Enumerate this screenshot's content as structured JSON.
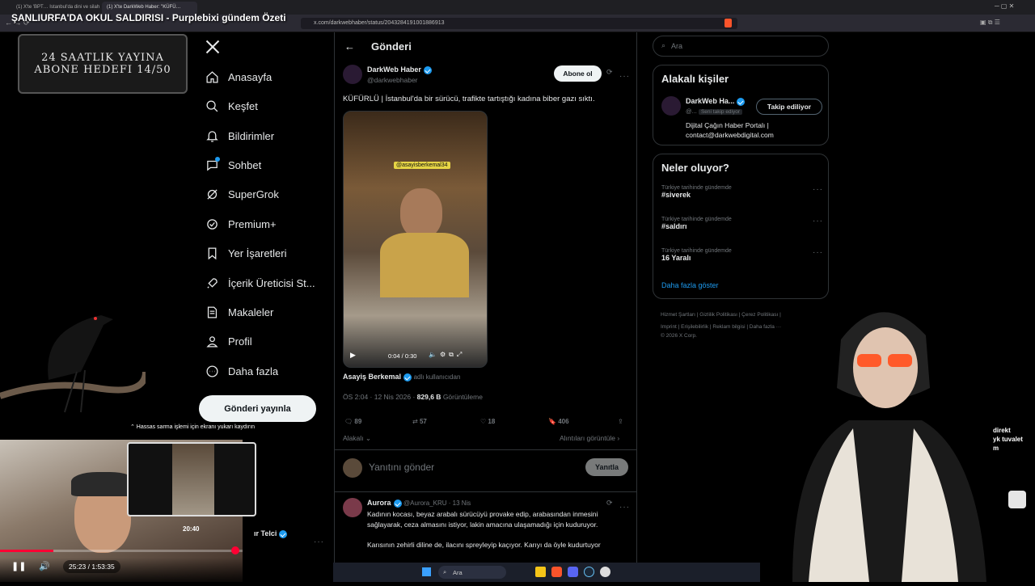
{
  "stream_title": "ŞANLIURFA'DA OKUL SALDIRISI - Purplebixi gündem Özeti",
  "browser": {
    "tabs": [
      "(1) X'te 'BPT… Istanbul'da dini ve silah…",
      "(1) X'te DarkWeb Haber: \"KÜFÜ…"
    ],
    "url": "x.com/darkwebhaber/status/2043284191001886913"
  },
  "overlay": {
    "banner_line1": "24 SAATLIK YAYINA",
    "banner_line2": "ABONE HEDEFI 14/50",
    "scroll_hint": "Hassas sarma işlemi için ekranı yukarı kaydırın",
    "preview_time": "20:40",
    "player_time": "25:23 / 1:53:35",
    "side_text": "direkt\nyk tuvalet\nm"
  },
  "nav": {
    "items": [
      {
        "label": "Anasayfa",
        "icon": "home-icon"
      },
      {
        "label": "Keşfet",
        "icon": "search-icon"
      },
      {
        "label": "Bildirimler",
        "icon": "bell-icon"
      },
      {
        "label": "Sohbet",
        "icon": "chat-icon"
      },
      {
        "label": "SuperGrok",
        "icon": "grok-icon"
      },
      {
        "label": "Premium+",
        "icon": "premium-icon"
      },
      {
        "label": "Yer İşaretleri",
        "icon": "bookmark-icon"
      },
      {
        "label": "İçerik Üreticisi St...",
        "icon": "rocket-icon"
      },
      {
        "label": "Makaleler",
        "icon": "article-icon"
      },
      {
        "label": "Profil",
        "icon": "person-icon"
      },
      {
        "label": "Daha fazla",
        "icon": "more-circle-icon"
      }
    ],
    "post_button": "Gönderi yayınla",
    "account_name": "ır Telci"
  },
  "post": {
    "header_title": "Gönderi",
    "author_name": "DarkWeb Haber",
    "author_handle": "@darkwebhaber",
    "subscribe_label": "Abone ol",
    "text": "KÜFÜRLÜ | İstanbul'da bir sürücü, trafikte tartıştığı kadına biber gazı sıktı.",
    "video_watermark": "@asayisberkemal34",
    "video_time": "0:04 / 0:30",
    "source_name": "Asayiş Berkemal",
    "source_suffix": "adlı kullanıcıdan",
    "timestamp": "ÖS 2:04 · 12 Nis 2026 · ",
    "views_count": "829,6 B",
    "views_label": " Görüntüleme",
    "replies": "89",
    "reposts": "57",
    "likes": "18",
    "bookmarks": "406",
    "sort_label": "Alakalı",
    "quotes_label": "Alıntıları görüntüle",
    "reply_placeholder": "Yanıtını gönder",
    "reply_button": "Yanıtla"
  },
  "reply": {
    "author_name": "Aurora",
    "meta": "@Aurora_KRU · 13 Nis",
    "line1": "Kadının kocası, beyaz arabalı sürücüyü provake edip, arabasından inmesini",
    "line2": "sağlayarak, ceza almasını istiyor, lakin amacına ulaşamadığı için kuduruyor.",
    "line3": "Karısının zehirli diline de, ilacını spreyleyip kaçıyor. Karıyı da öyle kudurtuyor"
  },
  "sidebar": {
    "search_placeholder": "Ara",
    "related_title": "Alakalı kişiler",
    "related_name": "DarkWeb Ha...",
    "related_handle": "@...",
    "related_badge": "Seni takip ediyor",
    "related_button": "Takip ediliyor",
    "related_bio_line1": "Dijital Çağın Haber Portalı |",
    "related_bio_line2": "contact@darkwebdigital.com",
    "trends_title": "Neler oluyor?",
    "trends": [
      {
        "kicker": "Türkiye tarihinde gündemde",
        "name": "#siverek"
      },
      {
        "kicker": "Türkiye tarihinde gündemde",
        "name": "#saldırı"
      },
      {
        "kicker": "Türkiye tarihinde gündemde",
        "name": "16 Yaralı"
      }
    ],
    "show_more": "Daha fazla göster",
    "footer_line1": "Hizmet Şartları  |  Gizlilik Politikası  |  Çerez Politikası  |",
    "footer_line2": "Imprint  |  Erişilebilirlik  |  Reklam bilgisi  |  Daha fazla ···",
    "footer_line3": "© 2026 X Corp."
  },
  "taskbar": {
    "search_placeholder": "Ara"
  },
  "colors": {
    "accent_blue": "#1d9bf0",
    "background": "#000000",
    "progress_red": "#ff0033"
  }
}
